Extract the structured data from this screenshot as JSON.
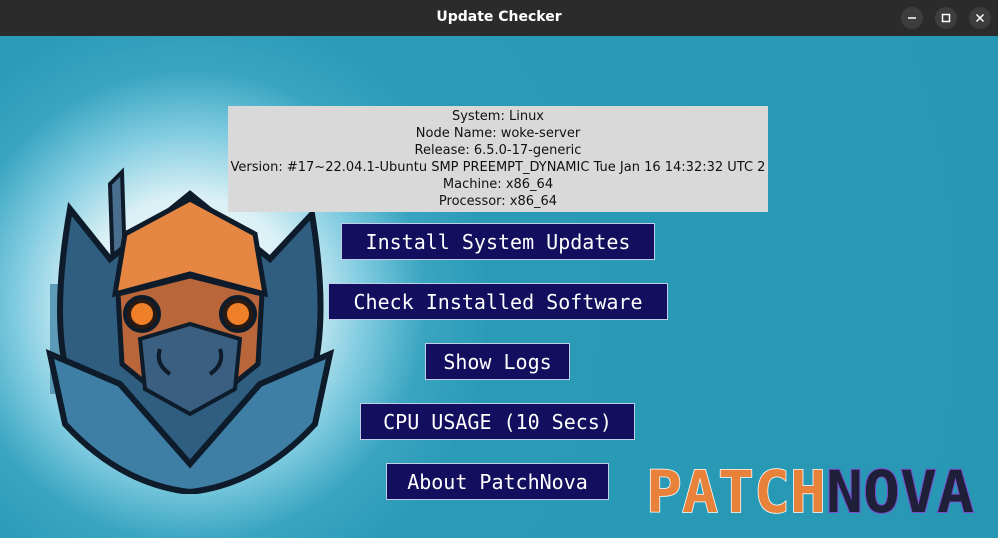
{
  "window": {
    "title": "Update Checker"
  },
  "system_info": {
    "system": "System: Linux",
    "node_name": "Node Name: woke-server",
    "release": "Release: 6.5.0-17-generic",
    "version": "Version: #17~22.04.1-Ubuntu SMP PREEMPT_DYNAMIC Tue Jan 16 14:32:32 UTC 2",
    "machine": "Machine: x86_64",
    "processor": "Processor: x86_64"
  },
  "buttons": {
    "install_updates": "Install System Updates",
    "check_software": "Check Installed Software",
    "show_logs": "Show Logs",
    "cpu_usage": "CPU USAGE (10 Secs)",
    "about": "About PatchNova"
  },
  "brand": {
    "part1": "PATCH",
    "part2": "NOVA",
    "color1": "#e8823a",
    "color2": "#1f1f3a"
  },
  "colors": {
    "background": "#2a9bb7",
    "button_bg": "#140e5e",
    "titlebar": "#2b2b2b"
  }
}
